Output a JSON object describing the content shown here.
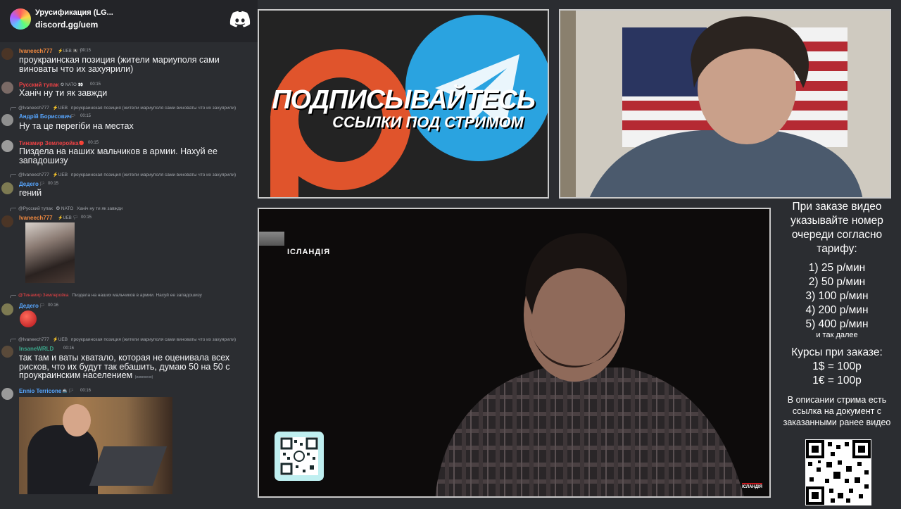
{
  "chat": {
    "server_name": "Урусификация (LG...",
    "server_link": "discord.gg/uem",
    "messages": [
      {
        "user": "Ivaneech777",
        "badges": "⚡UEB 🏴‍☠️ 🏳",
        "time": "00:15",
        "text": "проукраинская позиция (жители мариуполя сами виноваты что их захуярили)"
      },
      {
        "user": "Русский тупак",
        "badges": "✪ NATO 👀",
        "time": "00:15",
        "text": "Ханіч ну ти як завжди"
      },
      {
        "reply_user": "@Ivaneech777",
        "reply_badges": "⚡UEB",
        "reply_text": "проукраинская позиция (жители мариуполя сами виноваты что их захуярили)",
        "user": "Андрій Борисович",
        "badges": "🏳",
        "time": "00:15",
        "text": "Ну та це перегіби на местах"
      },
      {
        "user": "Тинамир Землеройка",
        "badges": "🔴",
        "time": "00:15",
        "text": "Пиздела на наших мальчиков в армии. Нахуй ее западошизу"
      },
      {
        "reply_user": "@Ivaneech777",
        "reply_badges": "⚡UEB",
        "reply_text": "проукраинская позиция (жители мариуполя сами виноваты что их захуярили)",
        "user": "Дедего",
        "badges": "🏳",
        "time": "00:15",
        "text": "гений"
      },
      {
        "reply_user": "@Русский тупак",
        "reply_badges": "✪ NATO",
        "reply_text": "Ханіч ну ти як завжди",
        "user": "Ivaneech777",
        "badges": "⚡UEB 🏳",
        "time": "00:15",
        "text": ""
      },
      {
        "reply_user": "@Тинамир Землеройка",
        "reply_badges": "",
        "reply_text": "Пиздела на наших мальчиков в армии. Нахуй ее западошизу",
        "user": "Дедего",
        "badges": "🏳",
        "time": "00:16",
        "text": ""
      },
      {
        "reply_user": "@Ivaneech777",
        "reply_badges": "⚡UEB",
        "reply_text": "проукраинская позиция (жители мариуполя сами виноваты что их захуярили)",
        "user": "InsaneWRLD",
        "badges": "",
        "time": "00:16",
        "text": "так там и ваты хватало, которая не оценивала всех рисков, что их будут так ебашить, думаю 50 на 50 с проукраинским населением",
        "edited": "(изменено)"
      },
      {
        "user": "Ennio Terricone",
        "badges": "🚢 🏳",
        "time": "00:16",
        "text": ""
      }
    ]
  },
  "promo": {
    "title": "ПОДПИСЫВАЙТЕСЬ",
    "subtitle": "ССЫЛКИ ПОД СТРИМОМ"
  },
  "video": {
    "label": "ІСЛАНДІЯ",
    "corner_label": "ІСЛАНДІЯ"
  },
  "info": {
    "order_intro": "При заказе видео указывайте номер очереди согласно тарифу:",
    "tariffs": [
      "1) 25 р/мин",
      "2) 50 р/мин",
      "3) 100 р/мин",
      "4) 200 р/мин",
      "5) 400 р/мин"
    ],
    "etc": "и так далее",
    "rates_title": "Курсы при заказе:",
    "rates": [
      "1$ = 100р",
      "1€ = 100р"
    ],
    "doc_note": "В описании стрима есть ссылка на документ с заказанными ранее видео"
  },
  "colors": {
    "chat_bg": "#2b2d31",
    "chat_header_bg": "#232428",
    "user_orange": "#f0883e",
    "user_red": "#ed4245",
    "user_blue": "#57a6ff",
    "user_teal": "#3ba58a",
    "patreon_orange": "#e0542c",
    "telegram_blue": "#2aa3e0"
  }
}
